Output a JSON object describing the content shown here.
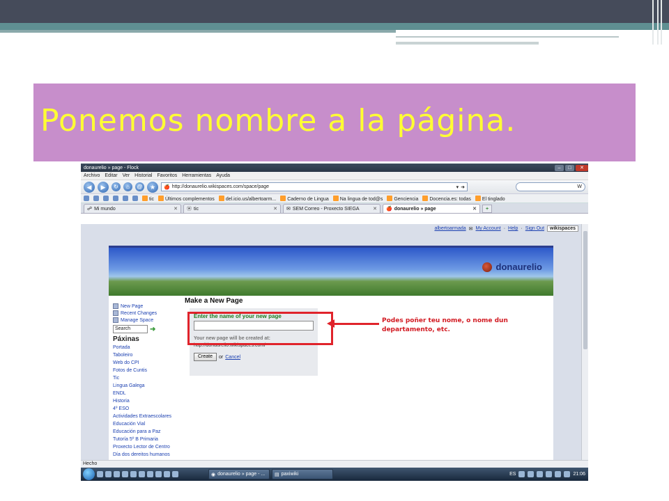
{
  "slide": {
    "title": "Ponemos nombre a la página."
  },
  "browser": {
    "window_title": "donaurelio » page - Flock",
    "menu": [
      "Archivo",
      "Editar",
      "Ver",
      "Historial",
      "Favoritos",
      "Herramientas",
      "Ayuda"
    ],
    "url": "http://donaurelio.wikispaces.com/space/page",
    "search_value": "W",
    "bookmarks": [
      "tic",
      "Últimos complementos",
      "del.icio.us/albertoarm...",
      "Caderno de Lingua",
      "Na lingua de tod@s",
      "Genciencia",
      "Docencia.es: todas",
      "El tinglado"
    ],
    "tabs": [
      {
        "label": "Mi mundo",
        "active": false
      },
      {
        "label": "tic",
        "active": false
      },
      {
        "label": "SEM Correo - Proxecto SIEGA",
        "active": false
      },
      {
        "label": "donaurelio » page",
        "active": true
      }
    ],
    "status": "Hecho"
  },
  "page": {
    "user_links": {
      "user": "albertoarmada",
      "account": "My Account",
      "help": "Help",
      "signout": "Sign Out",
      "brand": "wikispaces"
    },
    "site_name": "donaurelio",
    "sidebar": {
      "new_page": "New Page",
      "recent_changes": "Recent Changes",
      "manage_space": "Manage Space",
      "search_value": "Search",
      "section_title": "Páxinas",
      "pages": [
        "Portada",
        "Taboleiro",
        "Web do CPI",
        "Fotos de Cuntis",
        "Tic",
        "Lingua Galega",
        "ENDL",
        "Historia",
        "4º ESO",
        "Actividades Extraescolares",
        "Educación Vial",
        "Educación para a Paz",
        "Tutoría 5º B Primaria",
        "Proxecto Lector de Centro",
        "Día dos dereitos humanos"
      ]
    },
    "heading": "Make a New Page",
    "form": {
      "label": "Enter the name of your new page",
      "input_value": "",
      "hint": "Your new page will be created at:",
      "url": "http://donaurelio.wikispaces.com/",
      "create_label": "Create",
      "or_text": "or",
      "cancel_label": "Cancel"
    },
    "annotation": "Podes poñer teu nome, o nome dun departamento, etc.",
    "annotation_color": "#d21a22"
  },
  "taskbar": {
    "tasks": [
      "donaurelio » page - ...",
      "paxiwiki"
    ],
    "lang": "ES",
    "clock": "21:06"
  },
  "colors": {
    "title_band": "#c78ecb",
    "title_text": "#ffff33",
    "highlight": "#e0232b"
  }
}
